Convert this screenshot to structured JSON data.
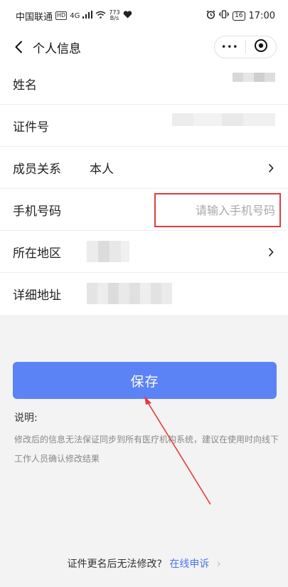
{
  "status_bar": {
    "carrier": "中国联通",
    "hd": "HD",
    "network": "4G",
    "speed_top": "773",
    "speed_bottom": "B/s",
    "battery": "16",
    "time": "17:00"
  },
  "nav": {
    "title": "个人信息",
    "more_label": "•••"
  },
  "form": {
    "name_label": "姓名",
    "id_label": "证件号",
    "relation_label": "成员关系",
    "relation_value": "本人",
    "phone_label": "手机号码",
    "phone_placeholder": "请输入手机号码",
    "phone_value": "",
    "region_label": "所在地区",
    "address_label": "详细地址"
  },
  "save_label": "保存",
  "note": {
    "title": "说明:",
    "text": "修改后的信息无法保证同步到所有医疗机构系统，建议在使用时向线下工作人员确认修改结果"
  },
  "footer": {
    "text": "证件更名后无法修改?",
    "link": "在线申诉",
    "chevron": "›"
  },
  "colors": {
    "primary": "#5b83f5",
    "highlight_border": "#e23b3b",
    "link": "#4a76e8"
  }
}
